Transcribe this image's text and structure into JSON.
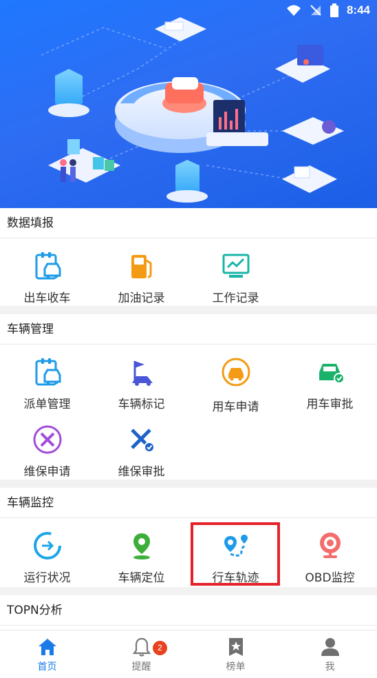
{
  "status_bar": {
    "time": "8:44"
  },
  "sections": [
    {
      "title": "数据填报",
      "items": [
        {
          "label": "出车收车",
          "icon": "car-clipboard-icon"
        },
        {
          "label": "加油记录",
          "icon": "fuel-pump-icon"
        },
        {
          "label": "工作记录",
          "icon": "monitor-chart-icon"
        }
      ]
    },
    {
      "title": "车辆管理",
      "items": [
        {
          "label": "派单管理",
          "icon": "car-clipboard-icon"
        },
        {
          "label": "车辆标记",
          "icon": "flag-car-icon"
        },
        {
          "label": "用车申请",
          "icon": "car-circle-icon"
        },
        {
          "label": "用车审批",
          "icon": "car-check-icon"
        },
        {
          "label": "维保申请",
          "icon": "tools-circle-icon"
        },
        {
          "label": "维保审批",
          "icon": "tools-check-icon"
        }
      ]
    },
    {
      "title": "车辆监控",
      "items": [
        {
          "label": "运行状况",
          "icon": "circular-arrow-icon"
        },
        {
          "label": "车辆定位",
          "icon": "location-pin-icon"
        },
        {
          "label": "行车轨迹",
          "icon": "route-pin-icon"
        },
        {
          "label": "OBD监控",
          "icon": "webcam-icon"
        }
      ]
    },
    {
      "title": "TOPN分析"
    }
  ],
  "tabbar": [
    {
      "label": "首页",
      "icon": "home-icon",
      "active": true
    },
    {
      "label": "提醒",
      "icon": "bell-icon",
      "badge": "2"
    },
    {
      "label": "榜单",
      "icon": "star-document-icon"
    },
    {
      "label": "我",
      "icon": "person-icon"
    }
  ],
  "colors": {
    "accent": "#1a7be8",
    "highlight_box": "#e5222b",
    "badge": "#e8411f"
  }
}
